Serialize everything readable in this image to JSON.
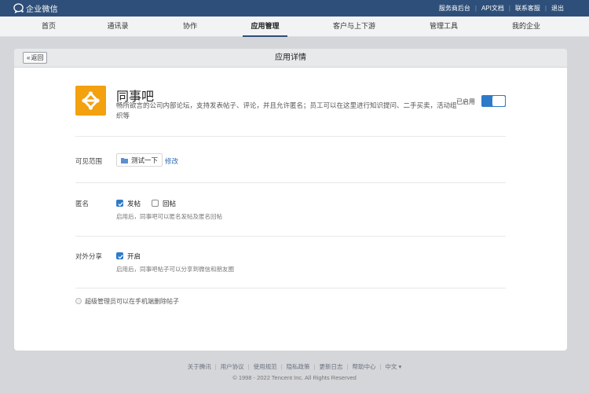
{
  "topbar": {
    "brand": "企业微信",
    "links": [
      "服务商后台",
      "API文档",
      "联系客服",
      "退出"
    ]
  },
  "nav": {
    "items": [
      "首页",
      "通讯录",
      "协作",
      "应用管理",
      "客户与上下游",
      "管理工具",
      "我的企业"
    ],
    "active": "应用管理"
  },
  "panel": {
    "back_label": "返回",
    "title": "应用详情"
  },
  "app": {
    "name": "同事吧",
    "description": "畅所欲言的公司内部论坛，支持发表帖子、评论，并且允许匿名；员工可以在这里进行知识提问、二手买卖，活动组织等",
    "enabled_label": "已启用",
    "enabled": true,
    "icon": "share-nodes-icon",
    "icon_color": "#f3a10f"
  },
  "scope": {
    "label": "可见范围",
    "chip": "测试一下",
    "modify": "修改"
  },
  "anonymous": {
    "label": "匿名",
    "options": [
      {
        "label": "发帖",
        "checked": true
      },
      {
        "label": "回帖",
        "checked": false
      }
    ],
    "hint": "启用后，同事吧可以匿名发帖及匿名回帖"
  },
  "share": {
    "label": "对外分享",
    "option": {
      "label": "开启",
      "checked": true
    },
    "hint": "启用后，同事吧帖子可以分享到微信和朋友圈"
  },
  "admin_option": "超级管理员可以在手机端删除帖子",
  "footer": {
    "links": [
      "关于腾讯",
      "用户协议",
      "使用规范",
      "隐私政策",
      "更新日志",
      "帮助中心",
      "中文 ▾"
    ],
    "copyright": "© 1998 - 2022 Tencent Inc. All Rights Reserved"
  },
  "colors": {
    "topbar": "#2e4f79",
    "accent": "#2e7ac9",
    "link": "#2e6cb5"
  }
}
